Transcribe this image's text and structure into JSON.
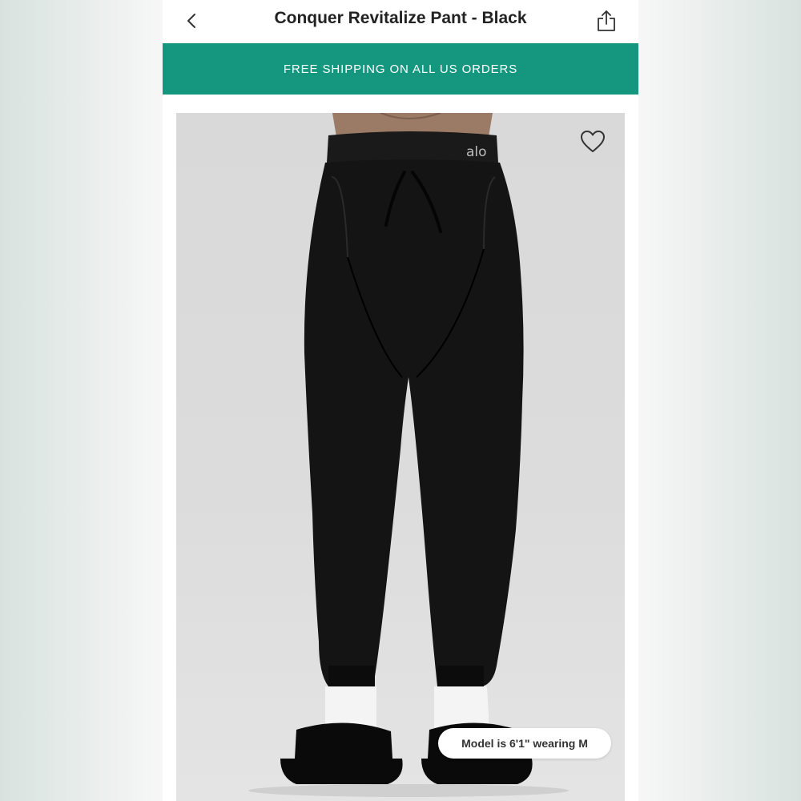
{
  "header": {
    "title": "Conquer Revitalize Pant - Black",
    "back_icon": "chevron-left-icon",
    "share_icon": "share-icon"
  },
  "promo": {
    "text": "FREE SHIPPING ON ALL US ORDERS",
    "background_color": "#15977f"
  },
  "product": {
    "image_alt": "Model wearing black jogger pants with white socks and black slides",
    "brand_mark": "alo",
    "wishlist_icon": "heart-icon",
    "model_info": "Model is 6'1\" wearing M"
  }
}
